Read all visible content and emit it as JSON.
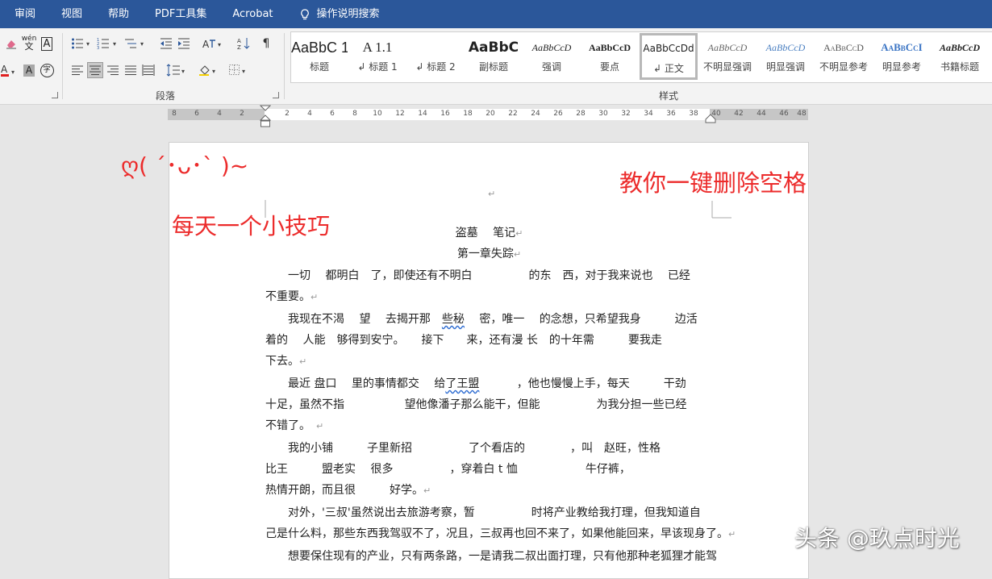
{
  "menu": {
    "items": [
      "审阅",
      "视图",
      "帮助",
      "PDF工具集",
      "Acrobat"
    ],
    "tell_me": "操作说明搜索"
  },
  "ribbon": {
    "paragraph_group_label": "段落",
    "styles_group_label": "样式",
    "styles": [
      {
        "preview": "AaBbC 1",
        "name": "标题",
        "prefix": ""
      },
      {
        "preview": "A 1.1",
        "name": "标题 1",
        "prefix": "↲ "
      },
      {
        "preview": "",
        "name": "标题 2",
        "prefix": "↲ "
      },
      {
        "preview": "AaBbC",
        "name": "副标题",
        "prefix": ""
      },
      {
        "preview": "AaBbCcD",
        "name": "强调",
        "prefix": ""
      },
      {
        "preview": "AaBbCcD",
        "name": "要点",
        "prefix": ""
      },
      {
        "preview": "AaBbCcDd",
        "name": "正文",
        "prefix": "↲ "
      },
      {
        "preview": "AaBbCcD",
        "name": "不明显强调",
        "prefix": ""
      },
      {
        "preview": "AaBbCcD",
        "name": "明显强调",
        "prefix": ""
      },
      {
        "preview": "AaBbCcD",
        "name": "不明显参考",
        "prefix": ""
      },
      {
        "preview": "AaBbCcI",
        "name": "明显参考",
        "prefix": ""
      },
      {
        "preview": "AaBbCcD",
        "name": "书籍标题",
        "prefix": ""
      }
    ],
    "font_buttons": {
      "wen": "wén",
      "wen_char": "文",
      "a_box": "A",
      "zi": "字"
    }
  },
  "ruler": {
    "left_ticks": [
      "8",
      "6",
      "4",
      "2"
    ],
    "right_ticks": [
      "2",
      "4",
      "6",
      "8",
      "10",
      "12",
      "14",
      "16",
      "18",
      "20",
      "22",
      "24",
      "26",
      "28",
      "30",
      "32",
      "34",
      "36",
      "38",
      "40",
      "42",
      "44",
      "46",
      "48"
    ]
  },
  "overlays": {
    "kaomoji": "ღ( ´･ᴗ･` )~",
    "daily_tip": "每天一个小技巧",
    "headline": "教你一键删除空格",
    "watermark": "头条 @玖点时光"
  },
  "document": {
    "mark": "↵",
    "title": "盗墓　 笔记",
    "chapter": "第一章失踪",
    "lines": [
      {
        "text": "一切　  都明白　了，即使还有不明白　　　　　的东　西，对于我来说也　 已经",
        "indent": true,
        "mark": false
      },
      {
        "text": "不重要。",
        "indent": false,
        "mark": true
      },
      {
        "text": "我现在不渴　 望　 去揭开那　",
        "squig": "些秘",
        "after": "　 密，唯一　 的念想，只希望我身　　　边活",
        "indent": true,
        "mark": false
      },
      {
        "text": "着的　 人能　够得到安宁。　　接下　　来，还有漫  长　的十年需　　　要我走",
        "indent": false,
        "mark": false
      },
      {
        "text": "下去。",
        "indent": false,
        "mark": true
      },
      {
        "text": "最近 盘口　  里的事情都交　 给",
        "squig": "了王盟",
        "after": "　　　 ，他也慢慢上手，每天　　　干劲",
        "indent": true,
        "mark": false
      },
      {
        "text": "十足，虽然不指　　　　　 望他像潘子那么能干，但能　　　　　为我分担一些已经",
        "indent": false,
        "mark": false
      },
      {
        "text": "不错了。　",
        "indent": false,
        "mark": true
      },
      {
        "text": "我的小铺　　　子里新招　　　　　了个看店的　　　　，叫　赵旺，性格",
        "indent": true,
        "mark": false
      },
      {
        "text": "比王　　　盟老实　 很多　　　　　，穿着白 t 恤　　　　　　牛仔裤，",
        "indent": false,
        "mark": false
      },
      {
        "text": "热情开朗，而且很　　　好学。",
        "indent": false,
        "mark": true
      },
      {
        "text": "对外，'三叔'虽然说出去旅游考察，暂　　　　　时将产业教给我打理，但我知道自",
        "indent": true,
        "mark": false
      },
      {
        "text": "己是什么料，那些东西我驾驭不了，况且，三叔再也回不来了，如果他能回来，早该现身了。",
        "indent": false,
        "mark": true
      },
      {
        "text": "想要保住现有的产业，只有两条路，一是请我二叔出面打理，只有他那种老狐狸才能驾",
        "indent": true,
        "mark": false
      }
    ]
  },
  "colors": {
    "menubar": "#2b579a",
    "overlay_red": "#ec2b2b",
    "ribbon_bg": "#f3f3f3",
    "workspace_bg": "#e6e6e6"
  }
}
